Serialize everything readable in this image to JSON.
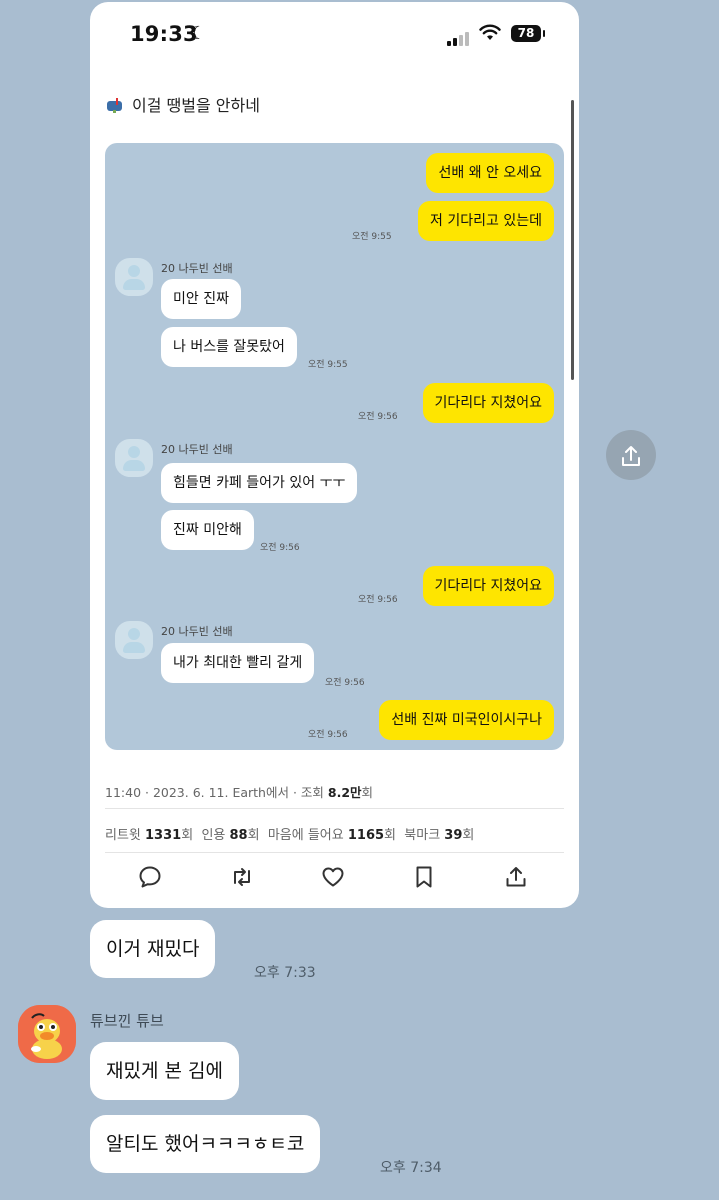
{
  "status_bar": {
    "time": "19:33",
    "battery": "78"
  },
  "tweet": {
    "text": "이걸 땡벌을 안하네",
    "meta_prefix": "11:40 · 2023. 6. 11. Earth에서 · 조회 ",
    "views": "8.2만",
    "meta_suffix": "회",
    "stats": [
      {
        "label": "리트윗 ",
        "value": "1331",
        "unit": "회"
      },
      {
        "label": "인용 ",
        "value": "88",
        "unit": "회"
      },
      {
        "label": "마음에 들어요 ",
        "value": "1165",
        "unit": "회"
      },
      {
        "label": "북마크 ",
        "value": "39",
        "unit": "회"
      }
    ]
  },
  "embedded_chat": {
    "mine": [
      {
        "text": "선배 왜 안 오세요"
      },
      {
        "text": "저 기다리고 있는데",
        "time": "오전 9:55"
      },
      {
        "text": "기다리다 지쳤어요",
        "time": "오전 9:56"
      },
      {
        "text": "기다리다 지쳤어요",
        "time": "오전 9:56"
      },
      {
        "text": "선배 진짜 미국인이시구나",
        "time": "오전 9:56"
      }
    ],
    "other_name": "20 나두빈 선배",
    "others": [
      {
        "text": "미안 진짜"
      },
      {
        "text": "나 버스를 잘못탔어",
        "time": "오전 9:55"
      },
      {
        "text": "힘들면 카페 들어가 있어 ㅜㅜ"
      },
      {
        "text": "진짜 미안해",
        "time": "오전 9:56"
      },
      {
        "text": "내가 최대한 빨리 갈게",
        "time": "오전 9:56"
      }
    ]
  },
  "chat": {
    "my_message": "이거 재밌다",
    "my_time": "오후 7:33",
    "friend_name": "튜브낀 튜브",
    "friend_messages": [
      "재밌게 본 김에",
      "알티도 했어ㅋㅋㅋㅎㅌ코"
    ],
    "friend_time": "오후 7:34"
  },
  "colors": {
    "background": "#a9bdd0",
    "my_bubble": "#fee500",
    "embedded_chat_bg": "#b2c7d9"
  },
  "icons": [
    "moon-icon",
    "signal-icon",
    "wifi-icon",
    "battery-icon",
    "reply-icon",
    "retweet-icon",
    "like-icon",
    "bookmark-icon",
    "share-icon"
  ]
}
